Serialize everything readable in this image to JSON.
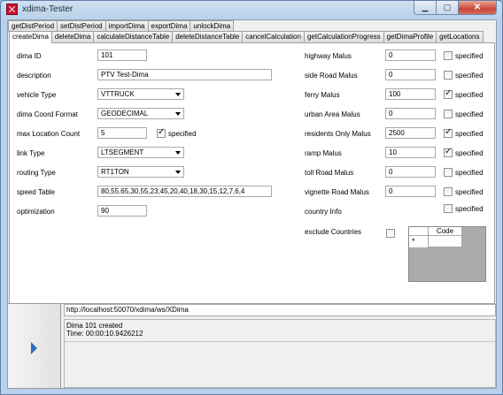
{
  "window": {
    "title": "xdima-Tester"
  },
  "tabs_row1": [
    "getDistPeriod",
    "setDistPeriod",
    "importDima",
    "exportDima",
    "unlockDima"
  ],
  "tabs_row2": [
    "createDima",
    "deleteDima",
    "calculateDistanceTable",
    "deleteDistanceTable",
    "cancelCalculation",
    "getCalculationProgress",
    "getDimaProfile",
    "getLocations"
  ],
  "form_left": {
    "dima_id": {
      "label": "dima ID",
      "value": "101"
    },
    "description": {
      "label": "description",
      "value": "PTV Test-Dima"
    },
    "vehicle_type": {
      "label": "vehicle Type",
      "value": "VTTRUCK"
    },
    "coord_format": {
      "label": "dima Coord Format",
      "value": "GEODECIMAL"
    },
    "max_location_count": {
      "label": "max Location Count",
      "value": "5",
      "specified_label": "specified",
      "specified": true
    },
    "link_type": {
      "label": "link Type",
      "value": "LTSEGMENT"
    },
    "routing_type": {
      "label": "routing Type",
      "value": "RT1TON"
    },
    "speed_table": {
      "label": "speed Table",
      "value": "80,55,65,30,55,23,45,20,40,18,30,15,12,7,6,4"
    },
    "optimization": {
      "label": "optimization",
      "value": "90"
    }
  },
  "form_right": [
    {
      "label": "highway Malus",
      "value": "0",
      "specified": false
    },
    {
      "label": "side Road Malus",
      "value": "0",
      "specified": false
    },
    {
      "label": "ferry Malus",
      "value": "100",
      "specified": true
    },
    {
      "label": "urban Area Malus",
      "value": "0",
      "specified": false
    },
    {
      "label": "residents Only Malus",
      "value": "2500",
      "specified": true
    },
    {
      "label": "ramp Malus",
      "value": "10",
      "specified": true
    },
    {
      "label": "toll Road Malus",
      "value": "0",
      "specified": false
    },
    {
      "label": "vignette Road Malus",
      "value": "0",
      "specified": false
    }
  ],
  "specified_label": "specified",
  "country_info": {
    "label": "country Info",
    "specified": false
  },
  "exclude_countries": {
    "label": "exclude Countries",
    "checked": false,
    "grid_column": "Code",
    "new_row_marker": "*"
  },
  "url": "http://localhost:50070/xdima/ws/XDima",
  "output": {
    "line1": "Dima 101 created",
    "line2": "Time: 00:00:10.9426212"
  },
  "colors": {
    "play_icon": "#2f6fb8",
    "window_frame": "#b9d1ea"
  }
}
